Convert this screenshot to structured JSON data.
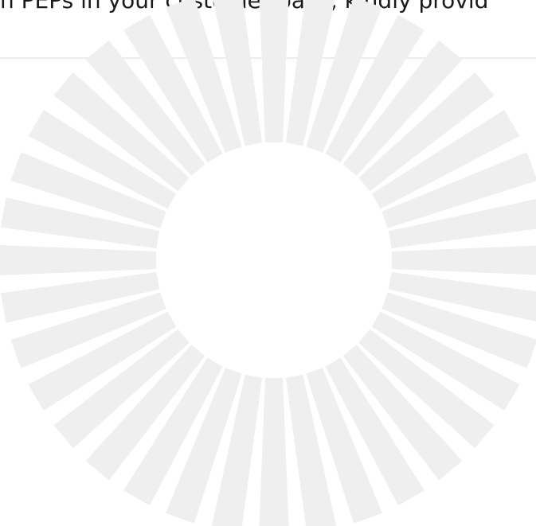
{
  "question": {
    "text": "n PEPs in your customer base, kindly provid"
  },
  "watermark": {
    "icon": "sunburst-icon",
    "color": "#efefef",
    "ray_count": 36
  }
}
